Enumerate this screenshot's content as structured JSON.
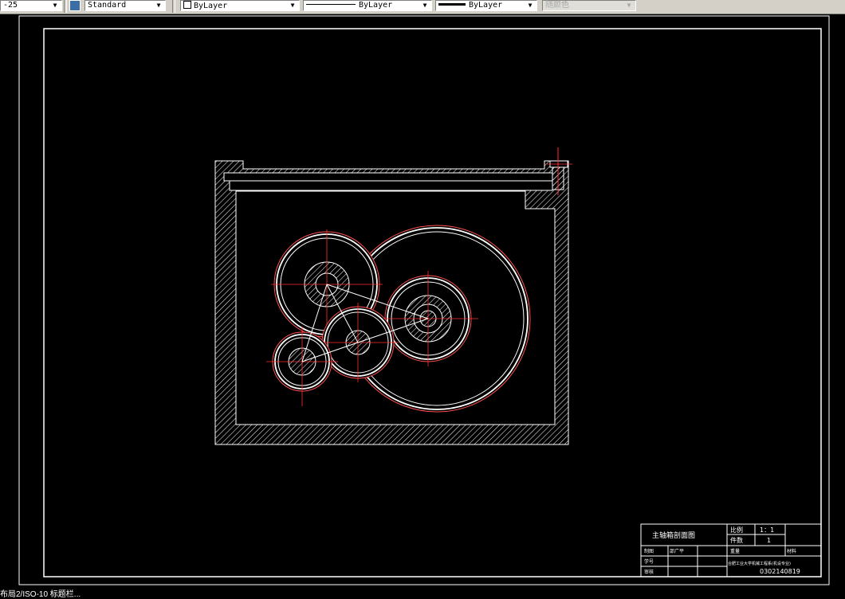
{
  "toolbar": {
    "dimstyle_value": "-25",
    "textstyle_value": "Standard",
    "layer_color_value": "ByLayer",
    "linetype_value": "ByLayer",
    "lineweight_value": "ByLayer",
    "plotstyle_value": "随颜色"
  },
  "title_block": {
    "drawing_name": "主轴箱剖面图",
    "scale_label": "比例",
    "scale_value": "1：1",
    "quantity_label": "件数",
    "quantity_value": "1",
    "drawn_label": "制图",
    "drawn_name": "邵广平",
    "weight_label": "重量",
    "material_label": "材料",
    "student_no_label": "学号",
    "review_label": "审核",
    "school_text": "合肥工业大学机械工程系(机设专业)",
    "drawing_no": "0302140819"
  },
  "status": {
    "command_line": "布局2/ISO-10 标题栏..."
  },
  "colors": {
    "background": "#000000",
    "lines": "#ffffff",
    "center_lines": "#ff0000"
  }
}
